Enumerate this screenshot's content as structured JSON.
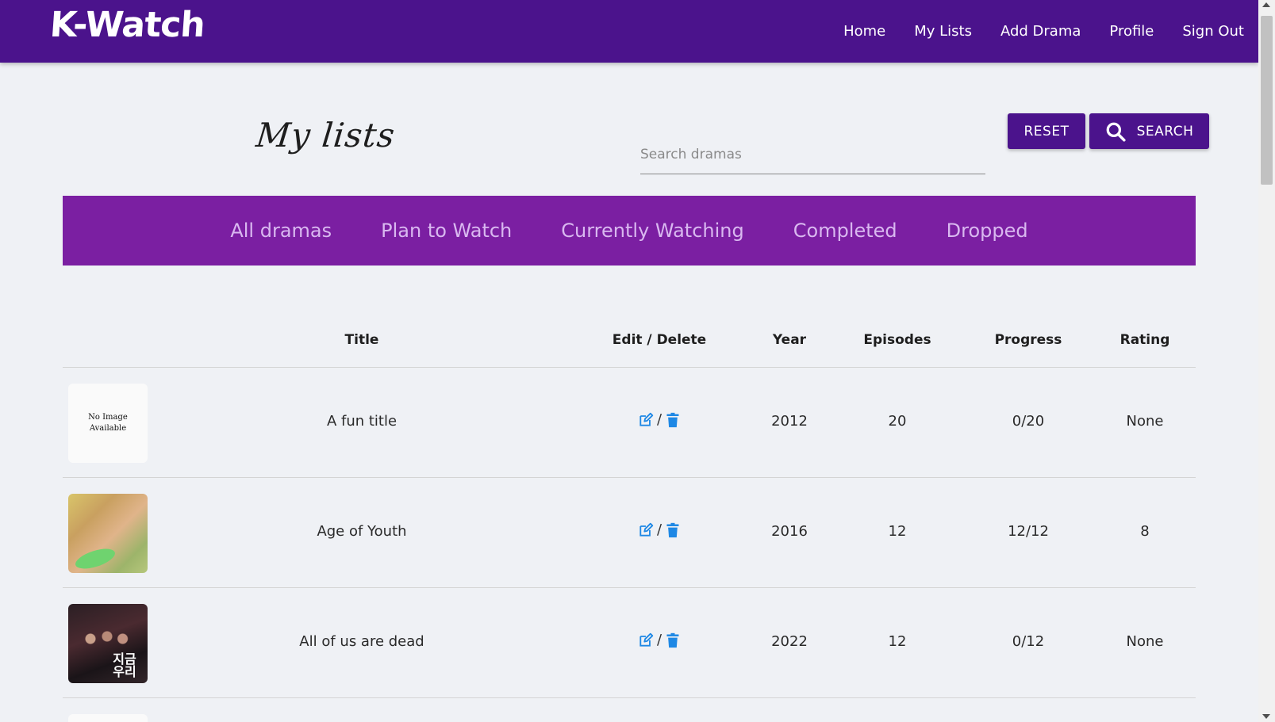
{
  "navbar": {
    "logo": "K-Watch",
    "links": [
      "Home",
      "My Lists",
      "Add Drama",
      "Profile",
      "Sign Out"
    ]
  },
  "page": {
    "title": "My lists",
    "search_placeholder": "Search dramas",
    "reset_label": "RESET",
    "search_label": "SEARCH"
  },
  "tabs": [
    "All dramas",
    "Plan to Watch",
    "Currently Watching",
    "Completed",
    "Dropped"
  ],
  "table": {
    "headers": {
      "title": "Title",
      "edit_delete": "Edit / Delete",
      "year": "Year",
      "episodes": "Episodes",
      "progress": "Progress",
      "rating": "Rating"
    },
    "rows": [
      {
        "title": "A fun title",
        "year": "2012",
        "episodes": "20",
        "progress": "0/20",
        "rating": "None",
        "image_text": "No Image Available"
      },
      {
        "title": "Age of Youth",
        "year": "2016",
        "episodes": "12",
        "progress": "12/12",
        "rating": "8"
      },
      {
        "title": "All of us are dead",
        "year": "2022",
        "episodes": "12",
        "progress": "0/12",
        "rating": "None",
        "poster_text": "지금 우리"
      }
    ],
    "separator": "/"
  },
  "colors": {
    "navbar": "#4b138c",
    "tabs": "#7b1fa2",
    "tab_text": "#d9b8f0",
    "icon": "#1e88e5"
  }
}
